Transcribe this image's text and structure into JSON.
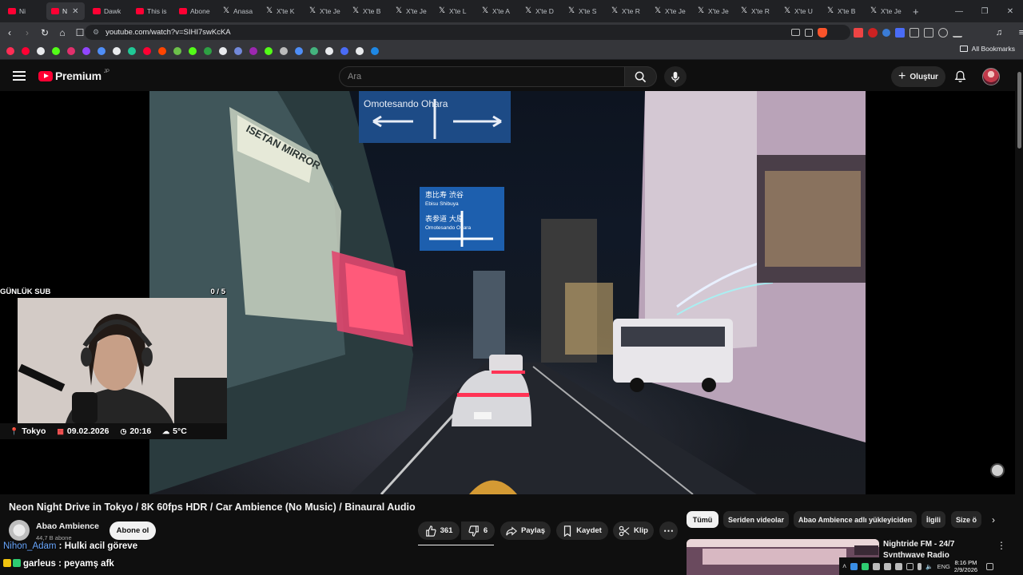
{
  "browser": {
    "tabs": [
      {
        "title": "Ni",
        "icon": "youtube-icon"
      },
      {
        "title": "N",
        "icon": "youtube-icon",
        "active": true
      },
      {
        "title": "Dawk",
        "icon": "youtube-icon"
      },
      {
        "title": "This is",
        "icon": "youtube-icon"
      },
      {
        "title": "Abone",
        "icon": "youtube-icon"
      },
      {
        "title": "Anasa",
        "icon": "x-icon"
      },
      {
        "title": "X'te K",
        "icon": "x-icon"
      },
      {
        "title": "X'te Je",
        "icon": "x-icon"
      },
      {
        "title": "X'te B",
        "icon": "x-icon"
      },
      {
        "title": "X'te Je",
        "icon": "x-icon"
      },
      {
        "title": "X'te L",
        "icon": "x-icon"
      },
      {
        "title": "X'te A",
        "icon": "x-icon"
      },
      {
        "title": "X'te D",
        "icon": "x-icon"
      },
      {
        "title": "X'te S",
        "icon": "x-icon"
      },
      {
        "title": "X'te R",
        "icon": "x-icon"
      },
      {
        "title": "X'te Je",
        "icon": "x-icon"
      },
      {
        "title": "X'te Je",
        "icon": "x-icon"
      },
      {
        "title": "X'te R",
        "icon": "x-icon"
      },
      {
        "title": "X'te U",
        "icon": "x-icon"
      },
      {
        "title": "X'te B",
        "icon": "x-icon"
      },
      {
        "title": "X'te Je",
        "icon": "x-icon"
      }
    ],
    "new_tab": "+",
    "url": "youtube.com/watch?v=SIHI7swKcKA",
    "all_bookmarks": "All Bookmarks",
    "bookmark_colors": [
      "#ff2d55",
      "#ff0033",
      "#e8eaed",
      "#53fc18",
      "#e1306c",
      "#9146ff",
      "#4f8ef7",
      "#e8eaed",
      "#20c997",
      "#ff0033",
      "#ff4500",
      "#6cc04a",
      "#53fc18",
      "#2ea043",
      "#e8eaed",
      "#7289da",
      "#9c27b0",
      "#53fc18",
      "#bbbbbb",
      "#4f8ef7",
      "#44b37e",
      "#e8eaed",
      "#4a6cf7",
      "#e8eaed",
      "#1e88e5"
    ]
  },
  "youtube": {
    "logo": "Premium",
    "region": "JP",
    "search_placeholder": "Ara",
    "create": "Oluştur"
  },
  "overlay": {
    "sub_label": "GÜNLÜK SUB",
    "sub_count": "0  / 5",
    "location": "Tokyo",
    "date": "09.02.2026",
    "time": "20:16",
    "temp": "5°C"
  },
  "video": {
    "title": "Neon Night Drive in Tokyo / 8K 60fps HDR / Car Ambience (No Music) / Binaural Audio",
    "channel": "Abao Ambience",
    "subscribers": "44,7 B abone",
    "subscribe": "Abone ol",
    "likes": "361",
    "dislikes": "6",
    "share": "Paylaş",
    "save": "Kaydet",
    "clip": "Klip",
    "sign_top": "Omotesando   Ohara",
    "sign_mid_1": "恵比寿   渋谷",
    "sign_mid_2": "Ebisu   Shibuya",
    "sign_mid_3": "表参道   大原",
    "sign_mid_4": "Omotesando   Ohara",
    "building_sign": "ISETAN MIRROR"
  },
  "chips": [
    "Tümü",
    "Seriden videolar",
    "Abao Ambience adlı yükleyiciden",
    "İlgili",
    "Size ö"
  ],
  "recommendation": {
    "title": "Nightride FM - 24/7 Synthwave Radio"
  },
  "chat": [
    {
      "user": "Nihon_Adam",
      "message": " : Hulki acil göreve"
    },
    {
      "user": "garleus",
      "message": " : peyamş afk"
    }
  ],
  "tray": {
    "lang": "ENG",
    "time": "8:16 PM",
    "date": "2/9/2026"
  }
}
